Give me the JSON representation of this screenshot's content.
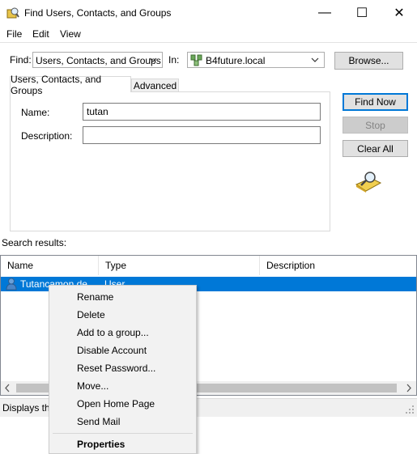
{
  "window": {
    "title": "Find Users, Contacts, and Groups",
    "minimize_glyph": "—",
    "maximize_glyph": "☐",
    "close_glyph": "✕"
  },
  "menu": {
    "file": "File",
    "edit": "Edit",
    "view": "View"
  },
  "find_row": {
    "find_label": "Find:",
    "find_value": "Users, Contacts, and Groups",
    "in_label": "In:",
    "in_value": "B4future.local",
    "browse_label": "Browse..."
  },
  "tabs": {
    "basic": "Users, Contacts, and Groups",
    "advanced": "Advanced"
  },
  "form": {
    "name_label": "Name:",
    "name_value": "tutan",
    "description_label": "Description:",
    "description_value": ""
  },
  "buttons": {
    "find_now": "Find Now",
    "stop": "Stop",
    "clear_all": "Clear All"
  },
  "results": {
    "label": "Search results:",
    "columns": [
      "Name",
      "Type",
      "Description"
    ],
    "rows": [
      {
        "name": "Tutancamon de",
        "type": "User",
        "description": ""
      }
    ]
  },
  "statusbar": {
    "text": "Displays th"
  },
  "context_menu": {
    "items": [
      "Rename",
      "Delete",
      "Add to a group...",
      "Disable Account",
      "Reset Password...",
      "Move...",
      "Open Home Page",
      "Send Mail"
    ],
    "default_item": "Properties"
  },
  "colors": {
    "accent": "#0078d7",
    "selection": "#0078d7",
    "menu_bg": "#f2f2f2"
  },
  "icons": {
    "title": "find-icon",
    "in_domain": "domain-icon",
    "search_graphic": "magnifier-folder-icon",
    "user_row": "user-icon",
    "scroll_left": "arrow-left-icon",
    "scroll_right": "arrow-right-icon"
  }
}
